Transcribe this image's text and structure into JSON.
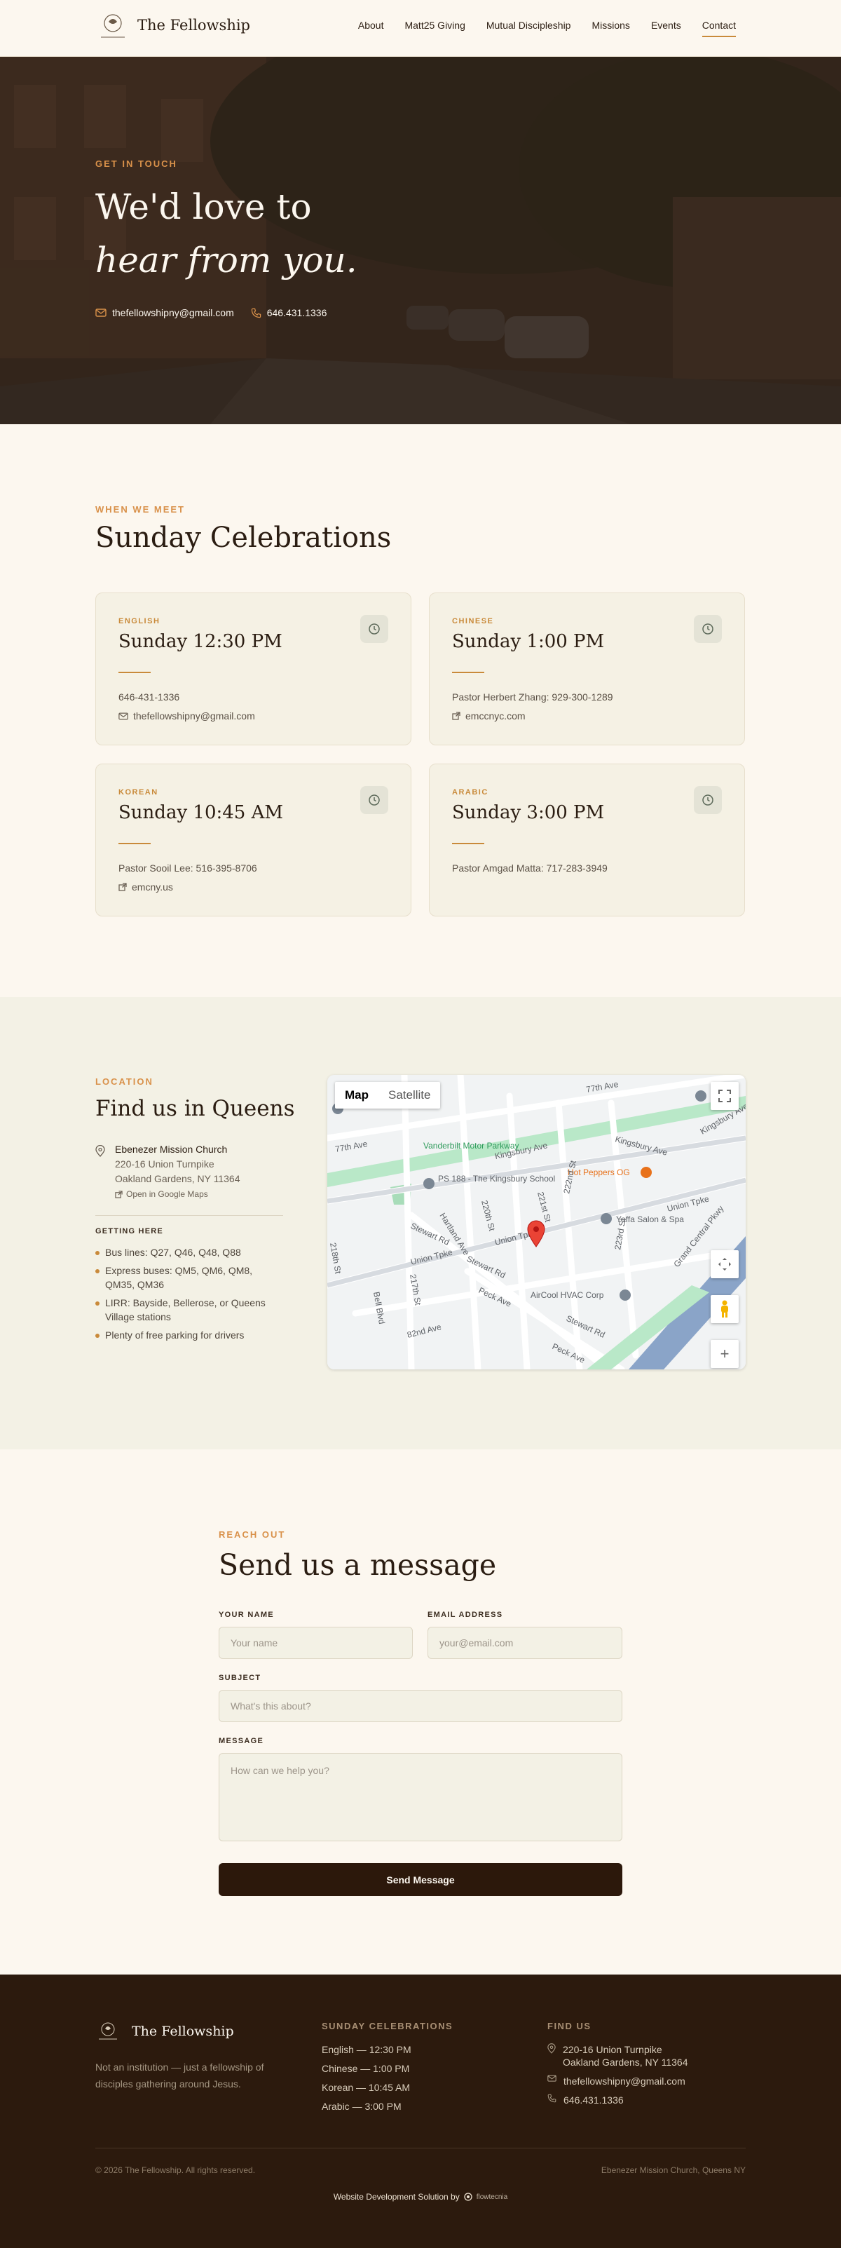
{
  "nav": {
    "brand": "The Fellowship",
    "links": [
      "About",
      "Matt25 Giving",
      "Mutual Discipleship",
      "Missions",
      "Events",
      "Contact"
    ],
    "active": "Contact"
  },
  "hero": {
    "eyebrow": "GET IN TOUCH",
    "title_line1": "We'd love to",
    "title_line2": "hear from you.",
    "email": "thefellowshipny@gmail.com",
    "phone": "646.431.1336"
  },
  "sunday": {
    "eyebrow": "WHEN WE MEET",
    "title": "Sunday Celebrations",
    "cards": [
      {
        "lang": "ENGLISH",
        "time": "Sunday 12:30 PM",
        "line1": "646-431-1336",
        "line2": "thefellowshipny@gmail.com",
        "line2_icon": "mail-icon"
      },
      {
        "lang": "CHINESE",
        "time": "Sunday 1:00 PM",
        "line1": "Pastor Herbert Zhang: 929-300-1289",
        "line2": "emccnyc.com",
        "line2_icon": "external-link-icon"
      },
      {
        "lang": "KOREAN",
        "time": "Sunday 10:45 AM",
        "line1": "Pastor Sooil Lee: 516-395-8706",
        "line2": "emcny.us",
        "line2_icon": "external-link-icon"
      },
      {
        "lang": "ARABIC",
        "time": "Sunday 3:00 PM",
        "line1": "Pastor Amgad Matta: 717-283-3949",
        "line2": "",
        "line2_icon": ""
      }
    ]
  },
  "location": {
    "eyebrow": "LOCATION",
    "title": "Find us in Queens",
    "church": "Ebenezer Mission Church",
    "address1": "220-16 Union Turnpike",
    "address2": "Oakland Gardens, NY 11364",
    "maps_link": "Open in Google Maps",
    "getting_here": "GETTING HERE",
    "directions": [
      "Bus lines: Q27, Q46, Q48, Q88",
      "Express buses: QM5, QM6, QM8, QM35, QM36",
      "LIRR: Bayside, Bellerose, or Queens Village stations",
      "Plenty of free parking for drivers"
    ],
    "map": {
      "tab_map": "Map",
      "tab_satellite": "Satellite",
      "labels": [
        "77th Ave",
        "77th Ave",
        "Kingsbury Ave",
        "Kingsbury Ave",
        "Vanderbilt Motor Parkway",
        "PS 188 - The Kingsbury School",
        "Hot Peppers OG",
        "Yaffa Salon & Spa",
        "Union Tpke",
        "Union Tpke",
        "Union Tpke",
        "Hartland Ave",
        "220th St",
        "221st St",
        "222nd St",
        "223rd St",
        "Stewart Rd",
        "Stewart Rd",
        "Stewart Rd",
        "AirCool HVAC Corp",
        "Bell Blvd",
        "217th St",
        "218th St",
        "Peck Ave",
        "Peck Ave",
        "82nd Ave",
        "Grand Central Pkwy",
        "Kingsbury Ave"
      ]
    }
  },
  "message": {
    "eyebrow": "REACH OUT",
    "title": "Send us a message",
    "name_label": "YOUR NAME",
    "name_placeholder": "Your name",
    "email_label": "EMAIL ADDRESS",
    "email_placeholder": "your@email.com",
    "subject_label": "SUBJECT",
    "subject_placeholder": "What's this about?",
    "message_label": "MESSAGE",
    "message_placeholder": "How can we help you?",
    "send": "Send Message"
  },
  "footer": {
    "brand": "The Fellowship",
    "tagline": "Not an institution — just a fellowship of disciples gathering around Jesus.",
    "col1_title": "SUNDAY CELEBRATIONS",
    "col1": [
      "English — 12:30 PM",
      "Chinese — 1:00 PM",
      "Korean — 10:45 AM",
      "Arabic — 3:00 PM"
    ],
    "col2_title": "FIND US",
    "address1": "220-16 Union Turnpike",
    "address2": "Oakland Gardens, NY 11364",
    "email": "thefellowshipny@gmail.com",
    "phone": "646.431.1336",
    "copyright": "© 2026 The Fellowship. All rights reserved.",
    "right": "Ebenezer Mission Church, Queens NY",
    "credit": "Website Development Solution by",
    "credit_brand": "flowtecnia"
  },
  "colors": {
    "accent": "#c98a3a",
    "dark": "#2c1a0d",
    "cream": "#fcf7ef",
    "card": "#f5f1e4"
  }
}
